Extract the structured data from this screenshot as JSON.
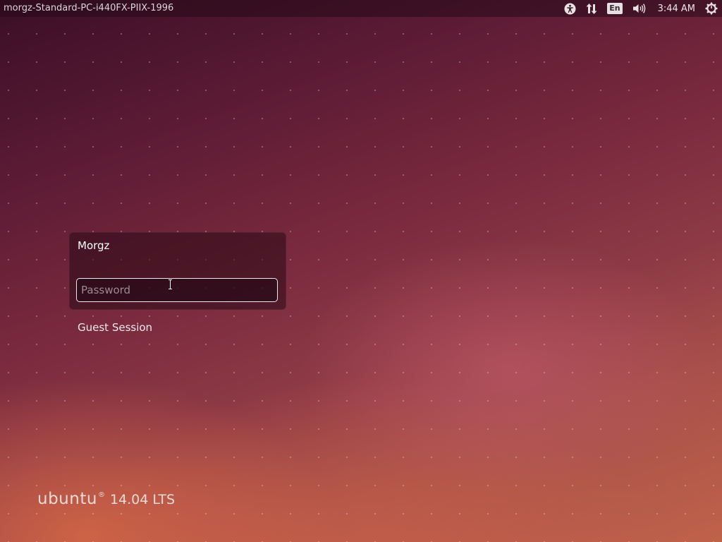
{
  "topbar": {
    "hostname": "morgz-Standard-PC-i440FX-PIIX-1996",
    "indicators": {
      "accessibility_icon": "accessibility-icon",
      "network_icon": "network-updown-icon",
      "language": "En",
      "volume_icon": "volume-icon",
      "clock": "3:44 AM",
      "power_icon": "power-gear-icon"
    }
  },
  "login": {
    "user_name": "Morgz",
    "password_placeholder": "Password",
    "password_value": ""
  },
  "guest_session_label": "Guest Session",
  "branding": {
    "wordmark": "ubuntu",
    "registered": "®",
    "version": "14.04 LTS"
  },
  "colors": {
    "background_dark": "#3a0f26",
    "background_warm": "#c0624a",
    "panel": "#280a16"
  }
}
